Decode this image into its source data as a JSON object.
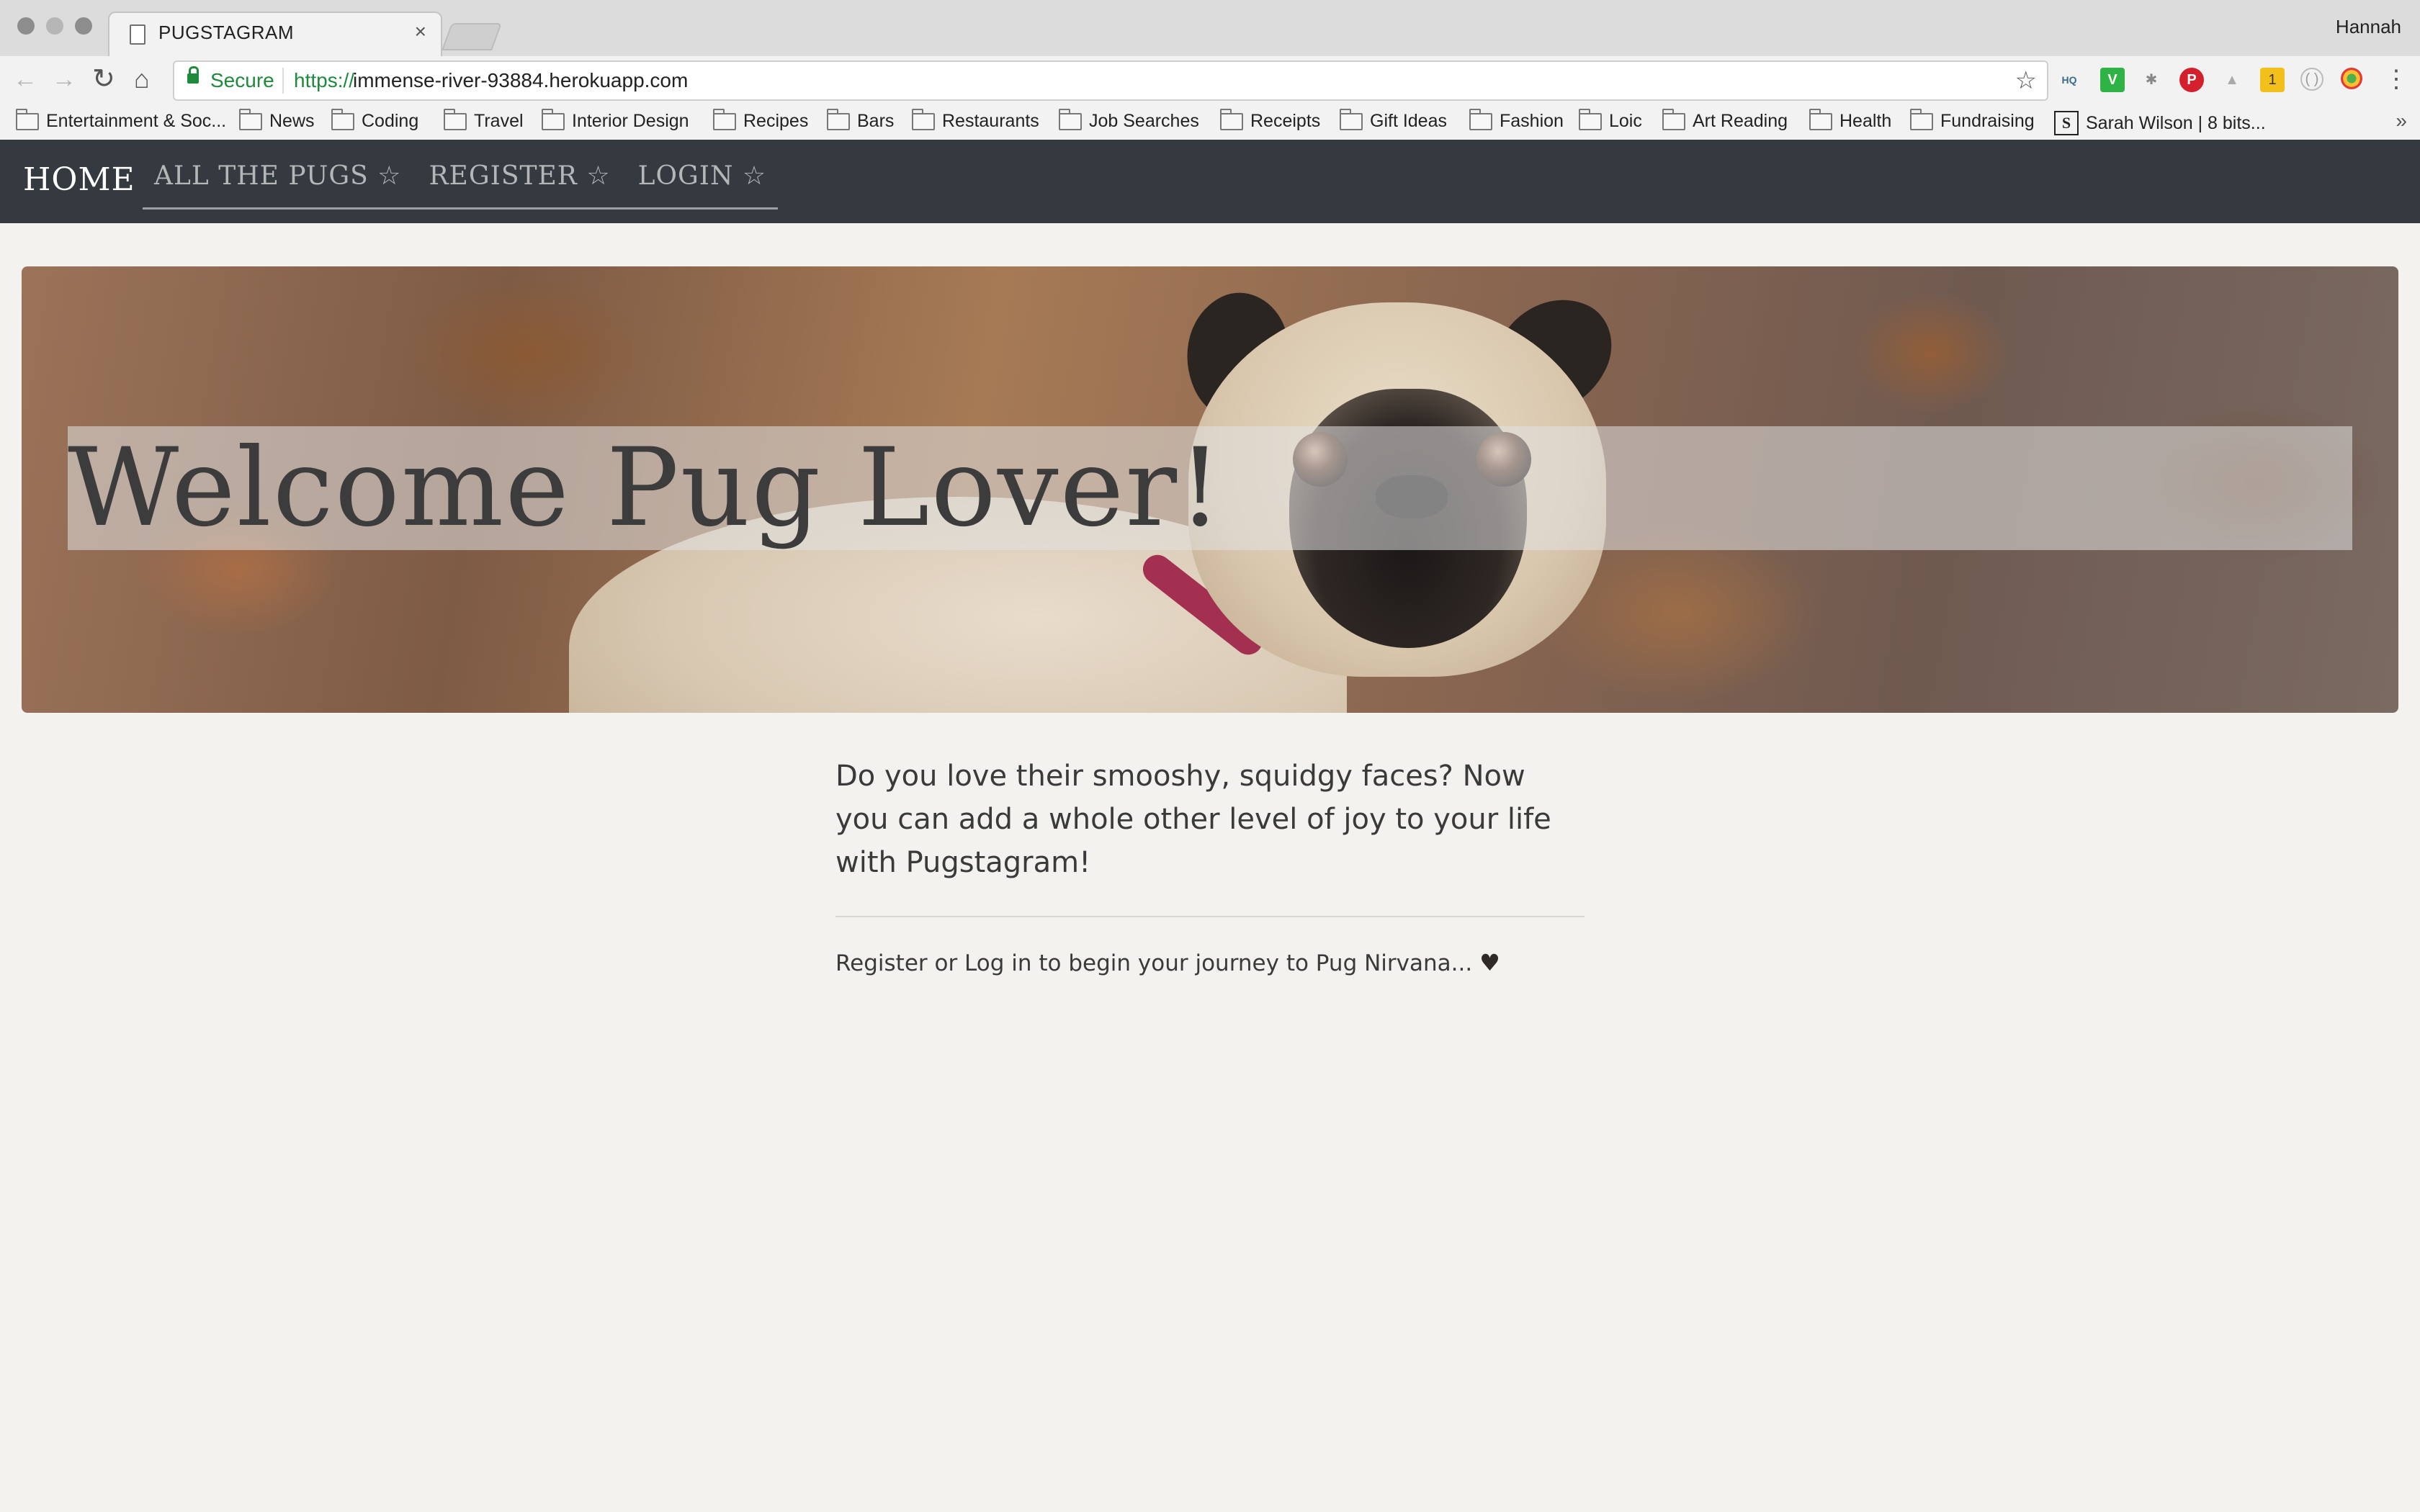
{
  "browser": {
    "tab_title": "PUGSTAGRAM",
    "tab_close_glyph": "×",
    "profile_name": "Hannah",
    "nav": {
      "back_glyph": "←",
      "forward_glyph": "→",
      "reload_glyph": "↻",
      "home_glyph": "⌂"
    },
    "address_bar": {
      "secure_label": "Secure",
      "url_scheme": "https://",
      "url_host": "immense-river-93884.herokuapp.com",
      "bookmark_star_glyph": "☆"
    },
    "extensions": [
      {
        "name": "cloudhq-extension-icon",
        "glyph": "HQ"
      },
      {
        "name": "v-extension-icon",
        "glyph": "V"
      },
      {
        "name": "bug-extension-icon",
        "glyph": "✱"
      },
      {
        "name": "pinterest-extension-icon",
        "glyph": "P"
      },
      {
        "name": "ghost-extension-icon",
        "glyph": "▲"
      },
      {
        "name": "notes-extension-icon",
        "glyph": "1"
      },
      {
        "name": "circle-extension-icon",
        "glyph": "( )"
      },
      {
        "name": "chrome-color-extension-icon",
        "glyph": ""
      }
    ],
    "menu_glyph": "⋮",
    "bookmarks": [
      {
        "label": "Entertainment & Soc...",
        "icon": "folder-icon"
      },
      {
        "label": "News",
        "icon": "folder-icon"
      },
      {
        "label": "Coding",
        "icon": "folder-icon"
      },
      {
        "label": "Travel",
        "icon": "folder-icon"
      },
      {
        "label": "Interior Design",
        "icon": "folder-icon"
      },
      {
        "label": "Recipes",
        "icon": "folder-icon"
      },
      {
        "label": "Bars",
        "icon": "folder-icon"
      },
      {
        "label": "Restaurants",
        "icon": "folder-icon"
      },
      {
        "label": "Job Searches",
        "icon": "folder-icon"
      },
      {
        "label": "Receipts",
        "icon": "folder-icon"
      },
      {
        "label": "Gift Ideas",
        "icon": "folder-icon"
      },
      {
        "label": "Fashion",
        "icon": "folder-icon"
      },
      {
        "label": "Loic",
        "icon": "folder-icon"
      },
      {
        "label": "Art Reading",
        "icon": "folder-icon"
      },
      {
        "label": "Health",
        "icon": "folder-icon"
      },
      {
        "label": "Fundraising",
        "icon": "folder-icon"
      },
      {
        "label": "Sarah Wilson | 8 bits...",
        "icon": "s-site-icon",
        "site_glyph": "S"
      }
    ],
    "bookmarks_overflow_glyph": "»"
  },
  "site": {
    "brand": "HOME",
    "nav_links": [
      {
        "label": "ALL THE PUGS ☆"
      },
      {
        "label": "REGISTER ☆"
      },
      {
        "label": "LOGIN ☆"
      }
    ],
    "hero": {
      "title": "Welcome Pug Lover!",
      "image_subject": "pug-photo"
    },
    "lead_text": "Do you love their smooshy, squidgy faces? Now you can add a whole other level of joy to your life with Pugstagram!",
    "cta_text": "Register or Log in to begin your journey to Pug Nirvana... ",
    "cta_heart_glyph": "♥"
  },
  "colors": {
    "navbar_bg": "#343a40",
    "page_bg": "#f3f2ee",
    "secure_green": "#1e8a3c"
  }
}
